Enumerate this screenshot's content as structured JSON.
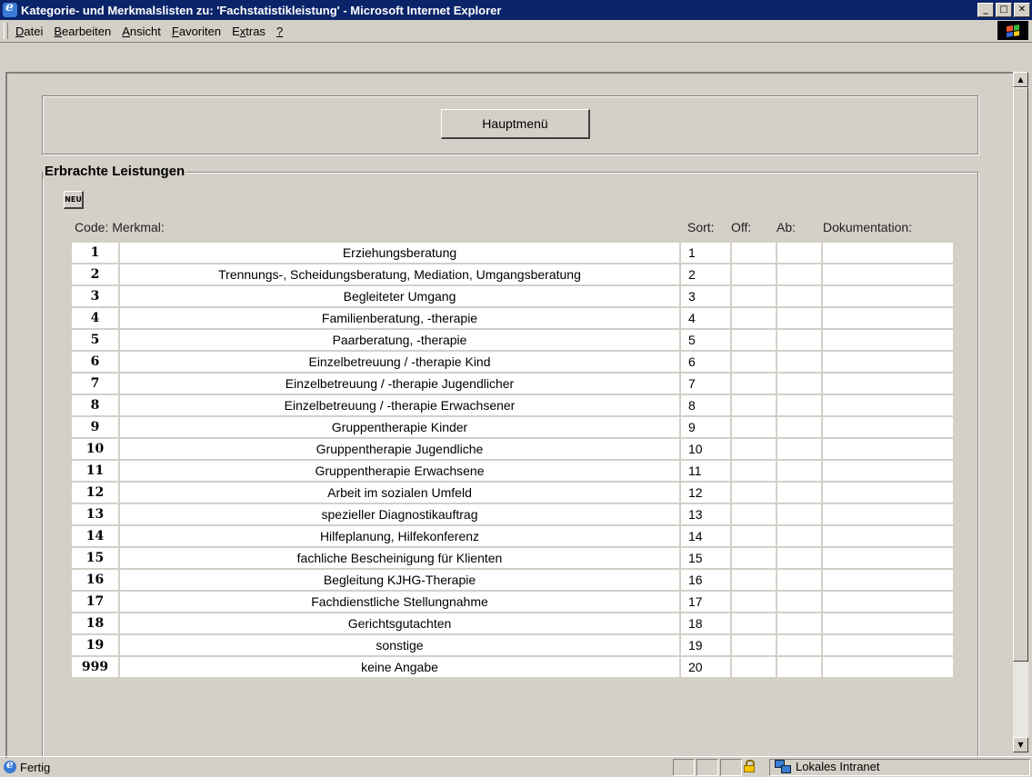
{
  "window": {
    "title": "Kategorie- und Merkmalslisten zu: 'Fachstatistikleistung' - Microsoft Internet Explorer"
  },
  "menu": [
    {
      "mn": "D",
      "rest": "atei"
    },
    {
      "mn": "B",
      "rest": "earbeiten"
    },
    {
      "mn": "A",
      "rest": "nsicht"
    },
    {
      "mn": "F",
      "rest": "avoriten"
    },
    {
      "pre": "E",
      "mn": "x",
      "rest": "tras"
    },
    {
      "mn": "?",
      "rest": ""
    }
  ],
  "page": {
    "main_menu_button": "Hauptmenü",
    "section_title": "Erbrachte Leistungen",
    "new_button": "NEU",
    "columns": {
      "code_name": "Code: Merkmal:",
      "sort": "Sort:",
      "off": "Off:",
      "ab": "Ab:",
      "doc": "Dokumentation:"
    },
    "rows": [
      {
        "code": "1",
        "name": "Erziehungsberatung",
        "sort": "1",
        "off": "",
        "ab": "",
        "doc": ""
      },
      {
        "code": "2",
        "name": "Trennungs-, Scheidungsberatung, Mediation, Umgangsberatung",
        "sort": "2",
        "off": "",
        "ab": "",
        "doc": ""
      },
      {
        "code": "3",
        "name": "Begleiteter Umgang",
        "sort": "3",
        "off": "",
        "ab": "",
        "doc": ""
      },
      {
        "code": "4",
        "name": "Familienberatung, -therapie",
        "sort": "4",
        "off": "",
        "ab": "",
        "doc": ""
      },
      {
        "code": "5",
        "name": "Paarberatung, -therapie",
        "sort": "5",
        "off": "",
        "ab": "",
        "doc": ""
      },
      {
        "code": "6",
        "name": "Einzelbetreuung / -therapie Kind",
        "sort": "6",
        "off": "",
        "ab": "",
        "doc": ""
      },
      {
        "code": "7",
        "name": "Einzelbetreuung / -therapie Jugendlicher",
        "sort": "7",
        "off": "",
        "ab": "",
        "doc": ""
      },
      {
        "code": "8",
        "name": "Einzelbetreuung / -therapie Erwachsener",
        "sort": "8",
        "off": "",
        "ab": "",
        "doc": ""
      },
      {
        "code": "9",
        "name": "Gruppentherapie Kinder",
        "sort": "9",
        "off": "",
        "ab": "",
        "doc": ""
      },
      {
        "code": "10",
        "name": "Gruppentherapie Jugendliche",
        "sort": "10",
        "off": "",
        "ab": "",
        "doc": ""
      },
      {
        "code": "11",
        "name": "Gruppentherapie Erwachsene",
        "sort": "11",
        "off": "",
        "ab": "",
        "doc": ""
      },
      {
        "code": "12",
        "name": "Arbeit im sozialen Umfeld",
        "sort": "12",
        "off": "",
        "ab": "",
        "doc": ""
      },
      {
        "code": "13",
        "name": "spezieller Diagnostikauftrag",
        "sort": "13",
        "off": "",
        "ab": "",
        "doc": ""
      },
      {
        "code": "14",
        "name": "Hilfeplanung, Hilfekonferenz",
        "sort": "14",
        "off": "",
        "ab": "",
        "doc": ""
      },
      {
        "code": "15",
        "name": "fachliche Bescheinigung für Klienten",
        "sort": "15",
        "off": "",
        "ab": "",
        "doc": ""
      },
      {
        "code": "16",
        "name": "Begleitung KJHG-Therapie",
        "sort": "16",
        "off": "",
        "ab": "",
        "doc": ""
      },
      {
        "code": "17",
        "name": "Fachdienstliche Stellungnahme",
        "sort": "17",
        "off": "",
        "ab": "",
        "doc": ""
      },
      {
        "code": "18",
        "name": "Gerichtsgutachten",
        "sort": "18",
        "off": "",
        "ab": "",
        "doc": ""
      },
      {
        "code": "19",
        "name": "sonstige",
        "sort": "19",
        "off": "",
        "ab": "",
        "doc": ""
      },
      {
        "code": "999",
        "name": "keine Angabe",
        "sort": "20",
        "off": "",
        "ab": "",
        "doc": ""
      }
    ]
  },
  "status": {
    "text": "Fertig",
    "zone": "Lokales Intranet"
  },
  "icons": {
    "app": "ie-icon",
    "minimize": "minimize-icon",
    "maximize": "maximize-icon",
    "close": "close-icon",
    "lock": "lock-icon",
    "zone": "intranet-icon"
  }
}
